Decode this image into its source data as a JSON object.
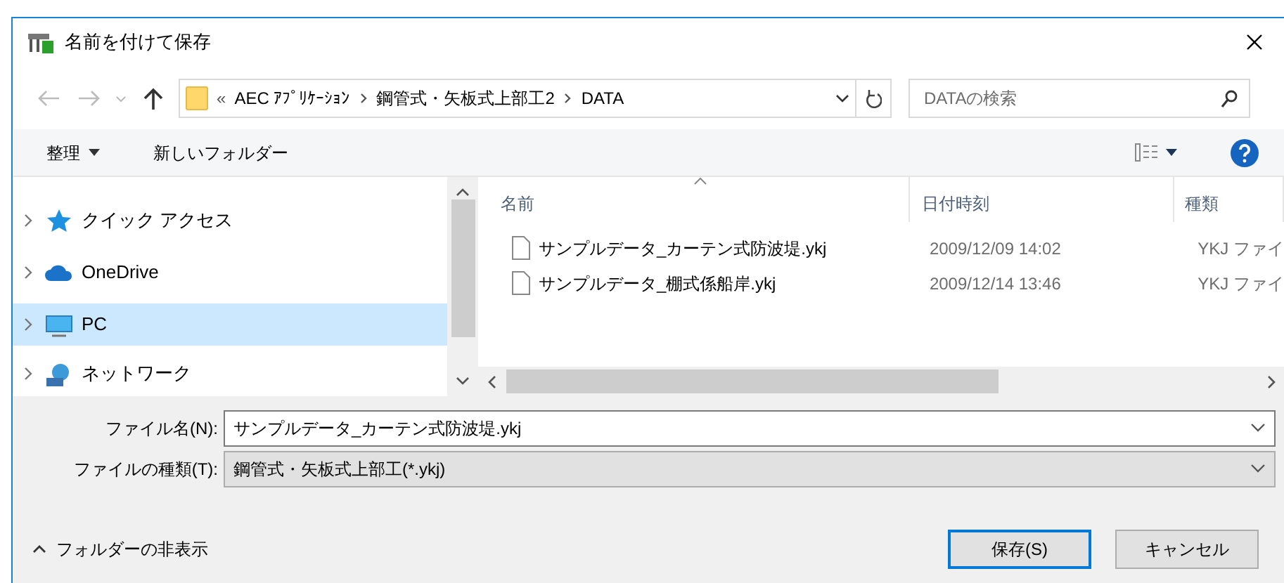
{
  "window": {
    "title": "名前を付けて保存"
  },
  "address": {
    "crumbs": [
      "«",
      "AEC ｱﾌﾟﾘｹｰｼｮﾝ",
      "鋼管式・矢板式上部工2",
      "DATA"
    ]
  },
  "search": {
    "placeholder": "DATAの検索"
  },
  "toolbar": {
    "organize": "整理",
    "new_folder": "新しいフォルダー"
  },
  "nav_pane": {
    "items": [
      {
        "label": "クイック アクセス",
        "kind": "quick-access",
        "selected": false
      },
      {
        "label": "OneDrive",
        "kind": "cloud",
        "selected": false
      },
      {
        "label": "PC",
        "kind": "pc",
        "selected": true
      },
      {
        "label": "ネットワーク",
        "kind": "network",
        "selected": false
      }
    ]
  },
  "file_list": {
    "columns": [
      {
        "label": "名前",
        "sorted": true
      },
      {
        "label": "日付時刻",
        "sorted": false
      },
      {
        "label": "種類",
        "sorted": false
      }
    ],
    "rows": [
      {
        "name": "サンプルデータ_カーテン式防波堤.ykj",
        "date": "2009/12/09 14:02",
        "type": "YKJ ファイ"
      },
      {
        "name": "サンプルデータ_棚式係船岸.ykj",
        "date": "2009/12/14 13:46",
        "type": "YKJ ファイ"
      }
    ]
  },
  "file_name": {
    "label": "ファイル名(N):",
    "value": "サンプルデータ_カーテン式防波堤.ykj"
  },
  "file_type": {
    "label": "ファイルの種類(T):",
    "value": "鋼管式・矢板式上部工(*.ykj)"
  },
  "hide_folders": "フォルダーの非表示",
  "buttons": [
    {
      "label": "保存(S)",
      "default": true
    },
    {
      "label": "キャンセル",
      "default": false
    }
  ]
}
